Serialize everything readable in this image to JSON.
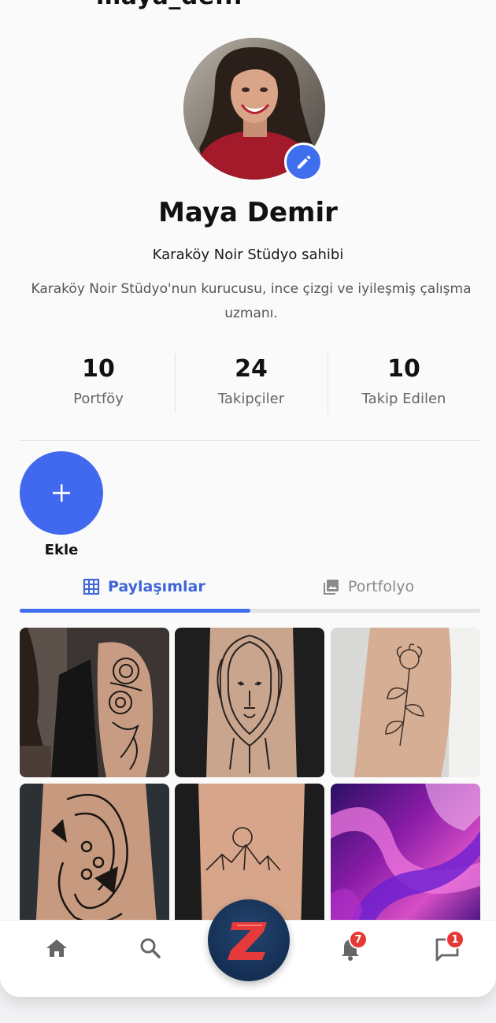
{
  "header": {
    "username": "maya_de..."
  },
  "profile": {
    "name": "Maya Demir",
    "subtitle": "Karaköy Noir Stüdyo sahibi",
    "bio": "Karaköy Noir Stüdyo'nun kurucusu, ince çizgi ve iyileşmiş çalışma uzmanı."
  },
  "stats": [
    {
      "value": "10",
      "label": "Portföy"
    },
    {
      "value": "24",
      "label": "Takipçiler"
    },
    {
      "value": "10",
      "label": "Takip Edilen"
    }
  ],
  "add": {
    "label": "Ekle"
  },
  "tabs": [
    {
      "label": "Paylaşımlar",
      "icon": "grid-icon",
      "active": true
    },
    {
      "label": "Portfolyo",
      "icon": "image-icon",
      "active": false
    }
  ],
  "grid": [
    {
      "name": "floral-sleeve-tattoo-photo"
    },
    {
      "name": "lion-tattoo-photo"
    },
    {
      "name": "fineline-flower-tattoo-photo"
    },
    {
      "name": "koi-fish-tattoo-photo"
    },
    {
      "name": "mountain-moon-tattoo-photo"
    },
    {
      "name": "purple-abstract-photo"
    }
  ],
  "nav": {
    "items": [
      "home-icon",
      "search-icon",
      "z-logo-button",
      "bell-icon",
      "chat-icon"
    ],
    "notifications_badge": "7",
    "messages_badge": "1"
  },
  "colors": {
    "accent": "#3f6fef",
    "badge": "#e53935",
    "logo_bg": "#152f54",
    "logo_z": "#e63a3a"
  }
}
